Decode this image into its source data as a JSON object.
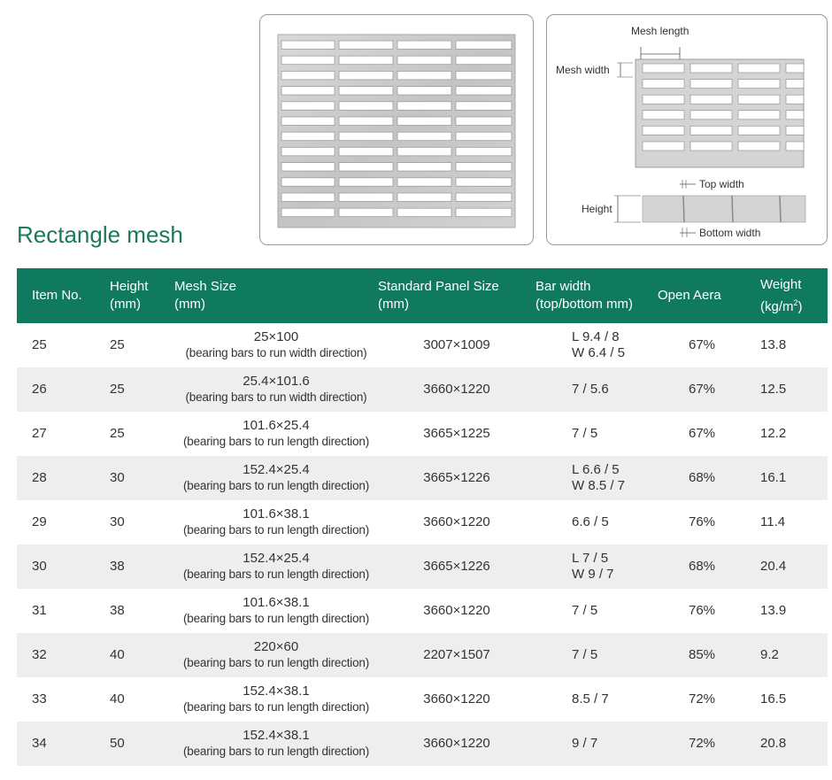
{
  "title": "Rectangle mesh",
  "diagram": {
    "mesh_length": "Mesh length",
    "mesh_width": "Mesh width",
    "top_width": "Top width",
    "height": "Height",
    "bottom_width": "Bottom width"
  },
  "table": {
    "headers": {
      "item": "Item No.",
      "height": [
        "Height",
        "(mm)"
      ],
      "mesh_size": [
        "Mesh Size",
        "(mm)"
      ],
      "panel_size": [
        "Standard Panel Size",
        "(mm)"
      ],
      "bar_width": [
        "Bar width",
        "(top/bottom  mm)"
      ],
      "open_area": "Open Aera",
      "weight": [
        "Weight",
        "(kg/m",
        "2",
        ")"
      ]
    },
    "rows": [
      {
        "item": "25",
        "height": "25",
        "mesh": "25×100",
        "note": "(bearing bars to run width direction)",
        "panel": "3007×1009",
        "bar": [
          "L 9.4 / 8",
          "W 6.4 / 5"
        ],
        "open": "67%",
        "weight": "13.8"
      },
      {
        "item": "26",
        "height": "25",
        "mesh": "25.4×101.6",
        "note": "(bearing bars to run width direction)",
        "panel": "3660×1220",
        "bar": [
          "7 / 5.6"
        ],
        "open": "67%",
        "weight": "12.5"
      },
      {
        "item": "27",
        "height": "25",
        "mesh": "101.6×25.4",
        "note": "(bearing bars to run length direction)",
        "panel": "3665×1225",
        "bar": [
          "7 / 5"
        ],
        "open": "67%",
        "weight": "12.2"
      },
      {
        "item": "28",
        "height": "30",
        "mesh": "152.4×25.4",
        "note": "(bearing bars to run length direction)",
        "panel": "3665×1226",
        "bar": [
          "L 6.6 / 5",
          "W 8.5 / 7"
        ],
        "open": "68%",
        "weight": "16.1"
      },
      {
        "item": "29",
        "height": "30",
        "mesh": "101.6×38.1",
        "note": "(bearing bars to run length direction)",
        "panel": "3660×1220",
        "bar": [
          "6.6 / 5"
        ],
        "open": "76%",
        "weight": "11.4"
      },
      {
        "item": "30",
        "height": "38",
        "mesh": "152.4×25.4",
        "note": "(bearing bars to run length direction)",
        "panel": "3665×1226",
        "bar": [
          "L 7 / 5",
          "W 9 / 7"
        ],
        "open": "68%",
        "weight": "20.4"
      },
      {
        "item": "31",
        "height": "38",
        "mesh": "101.6×38.1",
        "note": "(bearing bars to run length direction)",
        "panel": "3660×1220",
        "bar": [
          "7 / 5"
        ],
        "open": "76%",
        "weight": "13.9"
      },
      {
        "item": "32",
        "height": "40",
        "mesh": "220×60",
        "note": "(bearing bars to run length direction)",
        "panel": "2207×1507",
        "bar": [
          "7 / 5"
        ],
        "open": "85%",
        "weight": "9.2"
      },
      {
        "item": "33",
        "height": "40",
        "mesh": "152.4×38.1",
        "note": "(bearing bars to run length direction)",
        "panel": "3660×1220",
        "bar": [
          "8.5 / 7"
        ],
        "open": "72%",
        "weight": "16.5"
      },
      {
        "item": "34",
        "height": "50",
        "mesh": "152.4×38.1",
        "note": "(bearing bars to run length direction)",
        "panel": "3660×1220",
        "bar": [
          "9 / 7"
        ],
        "open": "72%",
        "weight": "20.8"
      }
    ]
  },
  "colors": {
    "header_bg": "#0f7a5e",
    "title": "#1a7a5a",
    "stripe": "#eeeeee",
    "grating": "#c8c8c8"
  }
}
